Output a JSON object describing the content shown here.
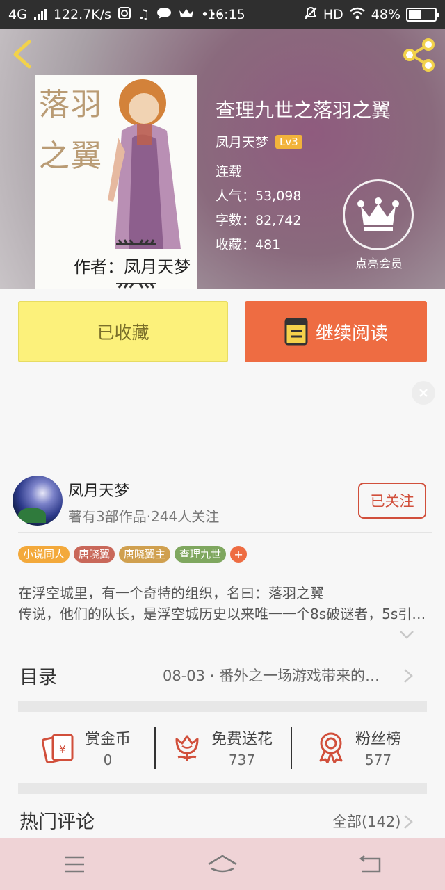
{
  "status_bar": {
    "network": "4G",
    "speed": "122.7K/s",
    "time": "16:15",
    "hd": "HD",
    "battery": "48%",
    "battery_level": 0.48
  },
  "book": {
    "title": "查理九世之落羽之翼",
    "author": "凤月天梦",
    "level": "Lv3",
    "status": "连载",
    "popularity": "人气：53,098",
    "word_count": "字数：82,742",
    "favorites": "收藏：481",
    "cover": {
      "title_line1": "落羽",
      "title_line2": "之翼",
      "author_line": "作者：凤月天梦"
    }
  },
  "vip": {
    "label": "点亮会员"
  },
  "actions": {
    "collected": "已收藏",
    "continue_reading": "继续阅读"
  },
  "author_card": {
    "name": "凤月天梦",
    "info": "著有3部作品·244人关注",
    "follow_label": "已关注"
  },
  "tags": [
    {
      "label": "小说同人",
      "color": "#f3a93b"
    },
    {
      "label": "唐晓翼",
      "color": "#c9685a"
    },
    {
      "label": "唐晓翼主",
      "color": "#d0a04f"
    },
    {
      "label": "查理九世",
      "color": "#7fa75f"
    }
  ],
  "tag_more": "+",
  "description": {
    "line1": "在浮空城里，有一个奇特的组织，名曰：落羽之翼",
    "line2": "传说，他们的队长，是浮空城历史以来唯一一个8s破谜者，5s引导…"
  },
  "toc": {
    "label": "目录",
    "latest": "08-03 · 番外之一场游戏带来的…"
  },
  "support": [
    {
      "label": "赏金币",
      "value": "0",
      "icon": "red-envelope-icon"
    },
    {
      "label": "免费送花",
      "value": "737",
      "icon": "flower-icon"
    },
    {
      "label": "粉丝榜",
      "value": "577",
      "icon": "medal-icon"
    }
  ],
  "comments": {
    "label": "热门评论",
    "all_link": "全部(142)"
  },
  "colors": {
    "accent": "#ee6c42",
    "collected_bg": "#fcf17b",
    "icon_yellow": "#f2d24b",
    "icon_red": "#d14f3b"
  }
}
